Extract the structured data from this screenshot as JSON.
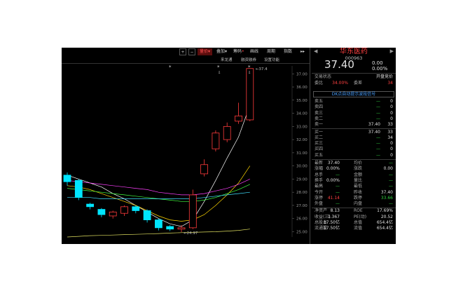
{
  "toolbar": {
    "plus": "+",
    "minus": "−",
    "items": [
      "量价",
      "叠加",
      "筹码",
      "画线",
      "周期",
      "指数"
    ],
    "more": "▸▸"
  },
  "subbar": {
    "items": [
      "来龙通",
      "融资融券",
      "设置功能"
    ]
  },
  "panel": {
    "stock_name": "华东医药",
    "code": "000963",
    "price": "37.40",
    "change": "0.00",
    "change_pct": "0.00%",
    "status_label": "交易状态",
    "status_value": "开盘竞价",
    "ratio_label": "委比",
    "ratio_value": "34.00%",
    "diff_label": "委差",
    "diff_value": "34",
    "notice": "DK点自动提示波段信号",
    "asks": [
      {
        "label": "卖五",
        "price": "—",
        "vol": "0"
      },
      {
        "label": "卖四",
        "price": "—",
        "vol": "0"
      },
      {
        "label": "卖三",
        "price": "—",
        "vol": "0"
      },
      {
        "label": "卖二",
        "price": "—",
        "vol": "0"
      },
      {
        "label": "卖一",
        "price": "37.40",
        "vol": "33"
      }
    ],
    "bids": [
      {
        "label": "买一",
        "price": "37.40",
        "vol": "33"
      },
      {
        "label": "买二",
        "price": "—",
        "vol": "34"
      },
      {
        "label": "买三",
        "price": "—",
        "vol": "0"
      },
      {
        "label": "买四",
        "price": "—",
        "vol": "0"
      },
      {
        "label": "买五",
        "price": "—",
        "vol": "0"
      }
    ],
    "stats": [
      {
        "l1": "最新",
        "v1": "37.40",
        "l2": "均价",
        "v2": "—"
      },
      {
        "l1": "涨幅",
        "v1": "0.00%",
        "l2": "涨跌",
        "v2": "0.00"
      },
      {
        "l1": "总手",
        "v1": "—",
        "l2": "金额",
        "v2": "—"
      },
      {
        "l1": "换手",
        "v1": "0.00%",
        "l2": "量比",
        "v2": "—"
      },
      {
        "l1": "最高",
        "v1": "—",
        "l2": "最低",
        "v2": "—"
      },
      {
        "l1": "今开",
        "v1": "—",
        "l2": "昨收",
        "v2": "37.40"
      },
      {
        "l1": "涨停",
        "v1": "41.14",
        "l2": "跌停",
        "v2": "33.66"
      },
      {
        "l1": "外盘",
        "v1": "—",
        "l2": "内盘",
        "v2": "—"
      }
    ],
    "fund": [
      {
        "l1": "净资产",
        "v1": "8.13",
        "l2": "ROE",
        "v2": "17.69%"
      },
      {
        "l1": "收益(三)",
        "v1": "1.367",
        "l2": "PE(动)",
        "v2": "20.52"
      },
      {
        "l1": "总股本",
        "v1": "17.50亿",
        "l2": "总值",
        "v2": "654.4亿"
      },
      {
        "l1": "流通股",
        "v1": "17.50亿",
        "l2": "流值",
        "v2": "654.4亿"
      }
    ]
  },
  "chart_data": {
    "type": "candlestick",
    "y_ticks": [
      "37.00",
      "36.00",
      "35.00",
      "34.00",
      "33.00",
      "32.00",
      "31.00",
      "30.00",
      "29.00",
      "28.00",
      "27.00",
      "26.00",
      "25.00"
    ],
    "ylim": [
      24.6,
      37.6
    ],
    "high_label": "37.4",
    "low_label": "24.97",
    "candles": [
      {
        "o": 28.8,
        "c": 29.3,
        "h": 29.5,
        "l": 28.5,
        "up": false
      },
      {
        "o": 28.9,
        "c": 27.6,
        "h": 29.0,
        "l": 27.4,
        "up": false
      },
      {
        "o": 27.1,
        "c": 26.9,
        "h": 27.2,
        "l": 26.7,
        "up": false
      },
      {
        "o": 26.7,
        "c": 26.3,
        "h": 26.8,
        "l": 26.1,
        "up": false
      },
      {
        "o": 26.2,
        "c": 26.5,
        "h": 26.6,
        "l": 26.0,
        "up": true
      },
      {
        "o": 26.4,
        "c": 26.9,
        "h": 27.0,
        "l": 26.2,
        "up": true
      },
      {
        "o": 26.9,
        "c": 26.6,
        "h": 27.0,
        "l": 26.4,
        "up": false
      },
      {
        "o": 26.6,
        "c": 25.9,
        "h": 26.7,
        "l": 25.7,
        "up": false
      },
      {
        "o": 25.9,
        "c": 25.3,
        "h": 26.0,
        "l": 25.1,
        "up": false
      },
      {
        "o": 25.4,
        "c": 25.2,
        "h": 25.5,
        "l": 25.05,
        "up": false
      },
      {
        "o": 25.2,
        "c": 25.3,
        "h": 25.5,
        "l": 24.97,
        "up": true
      },
      {
        "o": 25.3,
        "c": 27.8,
        "h": 28.2,
        "l": 25.2,
        "up": true
      },
      {
        "o": 29.4,
        "c": 30.1,
        "h": 30.5,
        "l": 29.2,
        "up": true
      },
      {
        "o": 31.3,
        "c": 32.5,
        "h": 32.7,
        "l": 31.1,
        "up": true
      },
      {
        "o": 32.0,
        "c": 33.0,
        "h": 33.3,
        "l": 31.8,
        "up": true
      },
      {
        "o": 33.4,
        "c": 33.8,
        "h": 34.8,
        "l": 33.2,
        "up": true
      },
      {
        "o": 33.5,
        "c": 37.4,
        "h": 37.4,
        "l": 33.4,
        "up": true
      }
    ],
    "ma_lines": [
      {
        "color": "#ffffff",
        "values": [
          29.3,
          29.0,
          28.7,
          28.4,
          27.9,
          27.5,
          27.0,
          26.5,
          26.0,
          25.6,
          25.4,
          25.9,
          27.3,
          28.9,
          30.6,
          32.2,
          34.6
        ]
      },
      {
        "color": "#ffd700",
        "values": [
          28.5,
          28.4,
          28.2,
          27.9,
          27.6,
          27.3,
          27.0,
          26.6,
          26.2,
          25.9,
          25.8,
          25.9,
          26.3,
          27.0,
          27.8,
          28.7,
          30.0
        ]
      },
      {
        "color": "#ff40ff",
        "values": [
          28.9,
          28.8,
          28.7,
          28.6,
          28.5,
          28.4,
          28.3,
          28.2,
          28.0,
          27.9,
          27.8,
          27.8,
          27.9,
          28.1,
          28.3,
          28.6,
          29.0
        ]
      },
      {
        "color": "#40ff40",
        "values": [
          28.3,
          28.2,
          28.1,
          28.0,
          27.9,
          27.8,
          27.7,
          27.6,
          27.5,
          27.4,
          27.3,
          27.3,
          27.4,
          27.6,
          27.9,
          28.2,
          28.6
        ]
      },
      {
        "color": "#40e0ff",
        "values": [
          27.6,
          27.6,
          27.6,
          27.5,
          27.5,
          27.5,
          27.5,
          27.5,
          27.5,
          27.5,
          27.5,
          27.5,
          27.6,
          27.7,
          27.8,
          27.9,
          28.0
        ]
      },
      {
        "color": "#e0e060",
        "values": [
          24.6,
          24.65,
          24.7,
          24.72,
          24.75,
          24.78,
          24.8,
          24.83,
          24.86,
          24.9,
          24.93,
          24.95,
          24.98,
          25.0,
          25.05,
          25.1,
          25.2
        ]
      }
    ]
  }
}
